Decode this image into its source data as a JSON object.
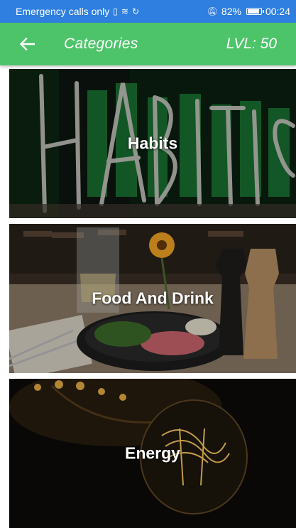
{
  "status_bar": {
    "carrier_text": "Emergency calls only",
    "battery": "82%",
    "time": "00:24"
  },
  "app_bar": {
    "title": "Categories",
    "level": "LVL: 50"
  },
  "categories": [
    {
      "label": "Habits"
    },
    {
      "label": "Food And Drink"
    },
    {
      "label": "Energy"
    }
  ],
  "colors": {
    "status_bar": "#2f7fe0",
    "app_bar": "#4ec46a",
    "text": "#ffffff"
  }
}
